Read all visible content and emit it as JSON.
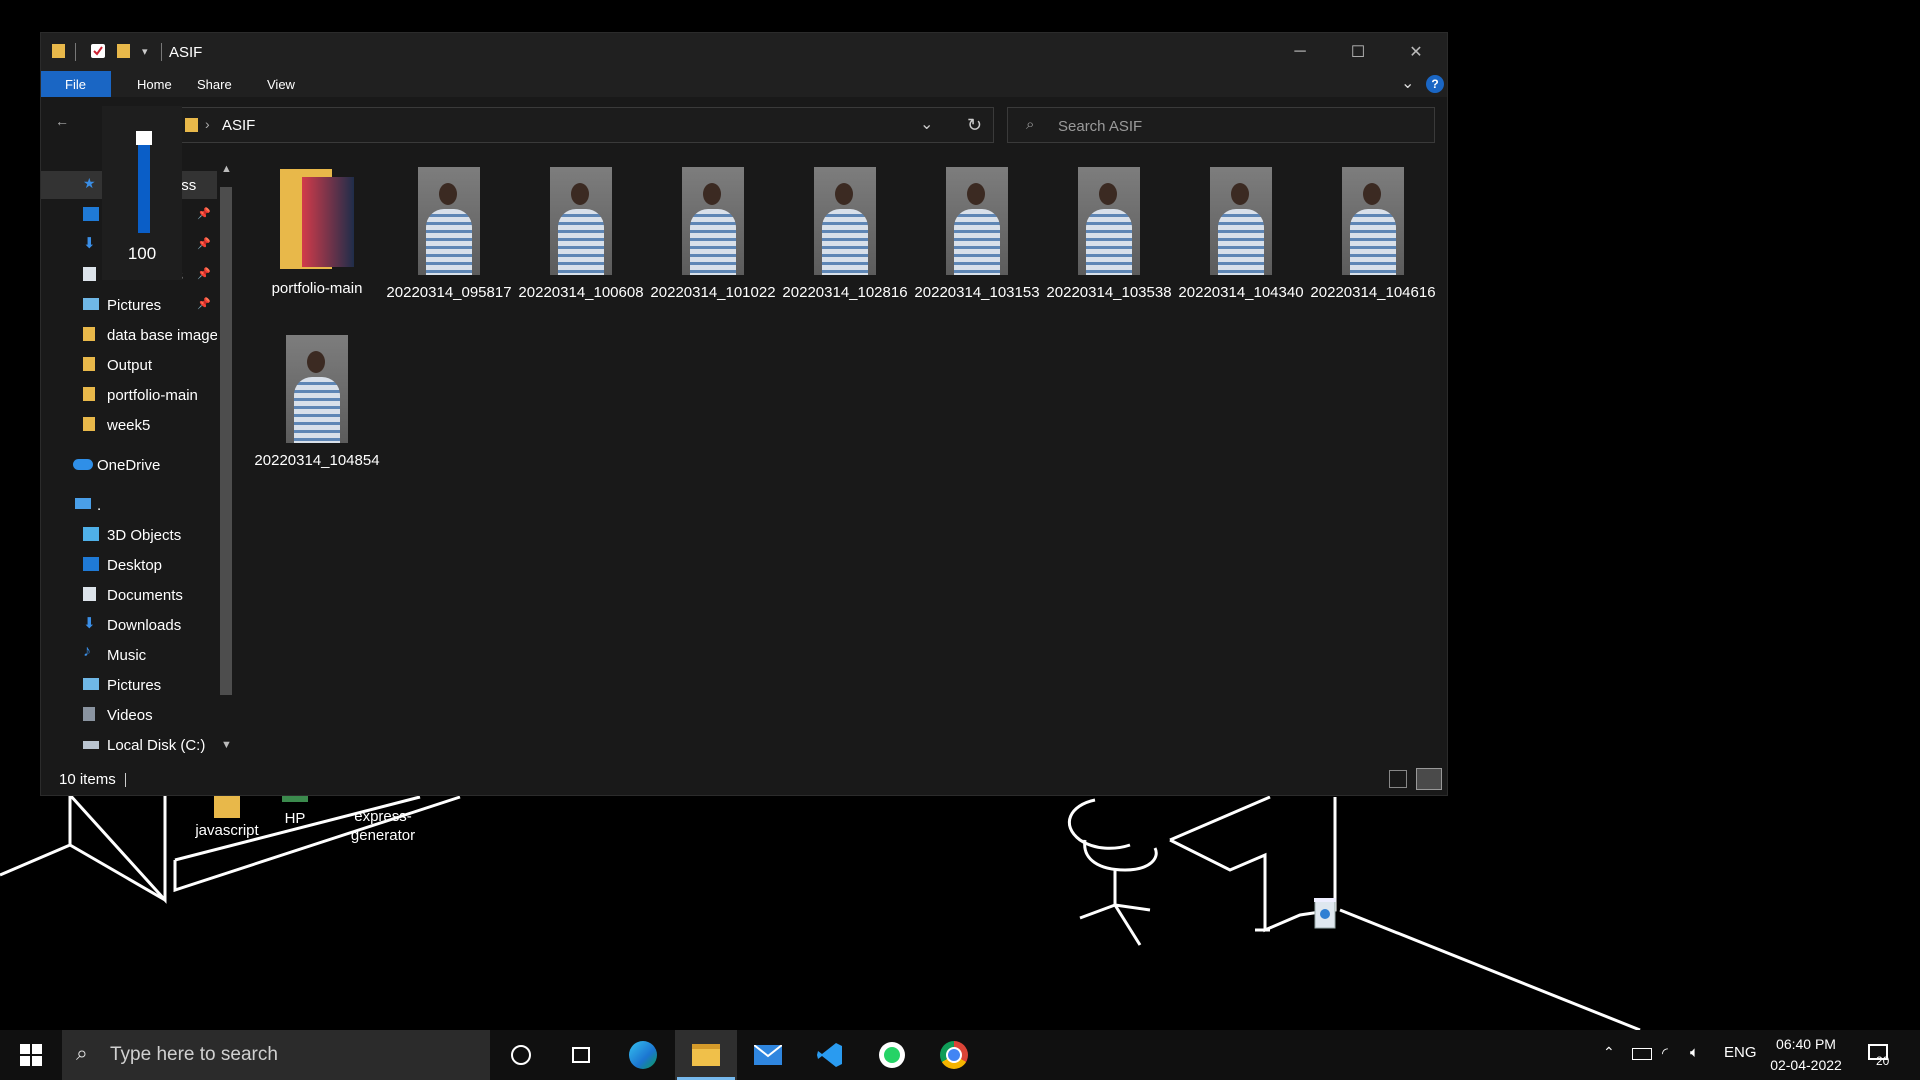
{
  "window": {
    "title": "ASIF",
    "controls": {
      "minimize": "─",
      "maximize": "☐",
      "close": "✕"
    }
  },
  "ribbon": {
    "tabs": [
      "File",
      "Home",
      "Share",
      "View"
    ]
  },
  "address": {
    "path": "ASIF",
    "search_placeholder": "Search ASIF"
  },
  "nav": {
    "quick_access": [
      {
        "label": "Quick access",
        "pinned": false
      },
      {
        "label": "Desktop",
        "pinned": true
      },
      {
        "label": "Downloads",
        "pinned": true
      },
      {
        "label": "Documents",
        "pinned": true
      },
      {
        "label": "Pictures",
        "pinned": true
      },
      {
        "label": "data base image",
        "pinned": false
      },
      {
        "label": "Output",
        "pinned": false
      },
      {
        "label": "portfolio-main",
        "pinned": false
      },
      {
        "label": "week5",
        "pinned": false
      }
    ],
    "onedrive": "OneDrive",
    "this_pc": ".",
    "this_pc_items": [
      "3D Objects",
      "Desktop",
      "Documents",
      "Downloads",
      "Music",
      "Pictures",
      "Videos",
      "Local Disk (C:)"
    ]
  },
  "files": [
    {
      "name": "portfolio-main",
      "type": "folder"
    },
    {
      "name": "20220314_095817",
      "type": "image"
    },
    {
      "name": "20220314_100608",
      "type": "image"
    },
    {
      "name": "20220314_101022",
      "type": "image"
    },
    {
      "name": "20220314_102816",
      "type": "image"
    },
    {
      "name": "20220314_103153",
      "type": "image"
    },
    {
      "name": "20220314_103538",
      "type": "image"
    },
    {
      "name": "20220314_104340",
      "type": "image"
    },
    {
      "name": "20220314_104616",
      "type": "image"
    },
    {
      "name": "20220314_104854",
      "type": "image"
    }
  ],
  "status": {
    "count": "10 items"
  },
  "volume": {
    "value": "100",
    "level": 1.0
  },
  "desktop_icons": [
    "javascript",
    "HP",
    "express-\ngenerator"
  ],
  "taskbar": {
    "search_placeholder": "Type here to search",
    "apps": [
      "cortana-icon",
      "task-view-icon",
      "edge-icon",
      "file-explorer-icon",
      "mail-icon",
      "vscode-icon",
      "whatsapp-icon",
      "chrome-icon"
    ],
    "language": "ENG",
    "time": "06:40 PM",
    "date": "02-04-2022",
    "notifications": "20"
  },
  "colors": {
    "accent": "#1a66c4",
    "window_bg": "#191919",
    "titlebar": "#202020",
    "taskbar": "#101010"
  }
}
